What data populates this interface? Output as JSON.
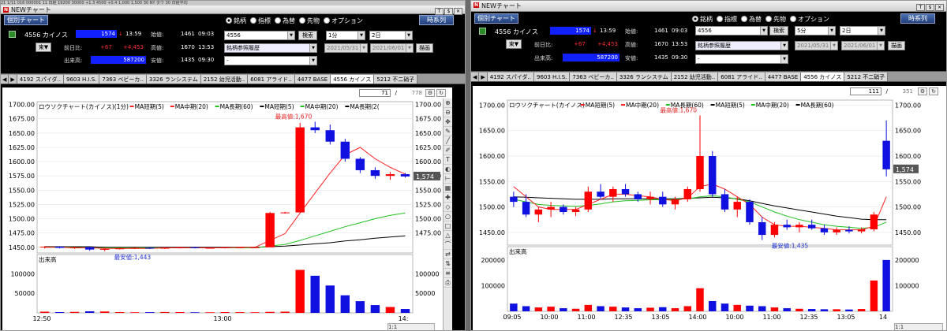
{
  "left_window": {
    "top_strip": "21   1/11     016  000001  11        日経  19200  30000  +1.3   4500  +0.4 1,000   1,500   30        NY ダウ   30   日経平均",
    "title": "NEWチャート",
    "ctrl_icons": [
      "T",
      "$",
      "✕"
    ],
    "mode_btn": "個別チャート",
    "radio_opts": [
      "銘柄",
      "指標",
      "為替",
      "先物",
      "オプション"
    ],
    "ts_btn": "時系列",
    "stock_code": "4556",
    "stock_name": "カイノス",
    "price": "1574",
    "arrow": "↓",
    "time": "13:59",
    "market_btn": "東▼",
    "labels": {
      "start": "始値:",
      "prev": "前日比:",
      "high": "高値:",
      "vol": "出来高:",
      "low": "安値:"
    },
    "start_val": "1461",
    "start_time": "09:03",
    "prev_diff": "+67",
    "prev_pct": "+4,453",
    "high_val": "1670",
    "high_time": "13:53",
    "volume": "587200",
    "low_val": "1435",
    "low_time": "09:30",
    "code_input": "4556",
    "search_btn": "検索",
    "interval": "1分",
    "range": "2日",
    "ref_select": "銘柄参照履歴",
    "date_from": "2021/05/31",
    "date_to": "2021/06/01",
    "draw_btn": "描画",
    "empty_select": "-",
    "tabs": [
      "4192 スパイダ..",
      "9603 H.I.S.",
      "7363 ベビーカ..",
      "3326 ランシステム",
      "2152 幼児活動..",
      "6081 アライド..",
      "4477 BASE",
      "4556 カイノス",
      "5212 不二硝子"
    ],
    "active_tab": 7,
    "nav_l": "◀",
    "nav_r": "▶",
    "count_cur": "71",
    "count_tot": "778",
    "legend": {
      "title": "ロウソクチャート(カイノス)(1分)",
      "s1": "MA短期(5)",
      "s2": "MA中期(20)",
      "s3": "MA長期(60)",
      "s4": "MA短期(5)",
      "s5": "MA中期(20)",
      "s6": "MA長期(2("
    },
    "high_note": "最高値:1,670",
    "low_note": "最安値:1,443",
    "price_tag": "1,574",
    "yaxis": [
      "1700.00",
      "1675.00",
      "1650.00",
      "1625.00",
      "1600.00",
      "1575.00",
      "1550.00",
      "1525.00",
      "1500.00",
      "1475.00",
      "1450.00"
    ],
    "yaxis_r": [
      "1700.00",
      "1675.00",
      "1650.00",
      "1625.00",
      "1600.00",
      "1575.00",
      "1550.00",
      "1525.00",
      "1500.00",
      "1475.00"
    ],
    "vol_title": "出来高",
    "vol_axis": [
      "100000",
      "50000"
    ],
    "vol_axis_l": [
      "100000",
      "50000"
    ],
    "xaxis": [
      "12:50",
      "13:00",
      "14:"
    ],
    "page_ctrl": "1:1"
  },
  "right_window": {
    "title": "NEWチャート",
    "ctrl_icons": [
      "T",
      "$",
      "✕"
    ],
    "mode_btn": "個別チャート",
    "radio_opts": [
      "銘柄",
      "指標",
      "為替",
      "先物",
      "オプション"
    ],
    "ts_btn": "時系列",
    "stock_code": "4556",
    "stock_name": "カイノス",
    "price": "1574",
    "arrow": "↓",
    "time": "13:59",
    "market_btn": "東▼",
    "labels": {
      "start": "始値:",
      "prev": "前日比:",
      "high": "高値:",
      "vol": "出来高:",
      "low": "安値:"
    },
    "start_val": "1461",
    "start_time": "09:03",
    "prev_diff": "+67",
    "prev_pct": "+4,453",
    "high_val": "1670",
    "high_time": "13:53",
    "volume": "587200",
    "low_val": "1435",
    "low_time": "09:30",
    "code_input": "4556",
    "search_btn": "検索",
    "interval": "5分",
    "range": "2日",
    "ref_select": "銘柄参照履歴",
    "date_from": "2021/05/31",
    "date_to": "2021/06/01",
    "draw_btn": "描画",
    "empty_select": "-",
    "tabs": [
      "4192 スパイダ..",
      "9603 H.I.S.",
      "7363 ベビーカ..",
      "3326 ランシステム",
      "2152 幼児活動..",
      "6081 アライド..",
      "4477 BASE",
      "4556 カイノス",
      "5212 不二硝子"
    ],
    "active_tab": 7,
    "nav_l": "◀",
    "nav_r": "▶",
    "count_cur": "111",
    "count_tot": "351",
    "legend": {
      "title": "ロウソクチャート(カイノス)",
      "s1": "MA短期(5)",
      "s2": "MA中期(20)",
      "s3": "MA長期(60)",
      "s4": "MA短期(5)",
      "s5": "MA中期(20)",
      "s6": "MA長期(60)"
    },
    "high_note": "最高値:1,670",
    "low_note": "最安値:1,435",
    "price_tag": "1,574",
    "yaxis": [
      "1700.00",
      "1650.00",
      "1600.00",
      "1550.00",
      "1500.00",
      "1450.00"
    ],
    "yaxis_r": [
      "1700.00",
      "1650.00",
      "1600.00",
      "1550.00",
      "1500.00",
      "1450.00"
    ],
    "vol_title": "出来高",
    "vol_axis": [
      "200000",
      "100000"
    ],
    "vol_axis_l": [
      "200000",
      "100000"
    ],
    "xaxis": [
      "09:05",
      "10:00",
      "11:00",
      "12:35",
      "13:05",
      "14:00",
      "10:00",
      "11:00",
      "12:35",
      "13:05",
      "14"
    ],
    "page_ctrl": "1:1"
  },
  "sidebar_icons": [
    "zoom-in",
    "zoom-out",
    "move",
    "draw",
    "line",
    "pen",
    "text",
    "color",
    "ruler",
    "grid",
    "cross",
    "tool",
    "tool",
    "tool",
    "tool",
    "tool",
    "tool",
    "tool",
    "tool",
    "print"
  ],
  "colors": {
    "up": "#ff0000",
    "down": "#1010e0",
    "ma_short": "#ff2020",
    "ma_mid": "#20c020",
    "ma_long": "#000000",
    "annotation": "#e02020"
  },
  "chart_data": [
    {
      "type": "candlestick",
      "title": "ロウソクチャート(カイノス)(1分)",
      "x_labels": [
        "12:50",
        "13:00",
        "14:"
      ],
      "ylim": [
        1440,
        1705
      ],
      "candles": [
        {
          "o": 1450,
          "h": 1452,
          "l": 1448,
          "c": 1451
        },
        {
          "o": 1451,
          "h": 1452,
          "l": 1448,
          "c": 1449
        },
        {
          "o": 1449,
          "h": 1451,
          "l": 1447,
          "c": 1450
        },
        {
          "o": 1450,
          "h": 1451,
          "l": 1444,
          "c": 1446
        },
        {
          "o": 1446,
          "h": 1449,
          "l": 1443,
          "c": 1447
        },
        {
          "o": 1447,
          "h": 1449,
          "l": 1446,
          "c": 1448
        },
        {
          "o": 1448,
          "h": 1450,
          "l": 1447,
          "c": 1449
        },
        {
          "o": 1449,
          "h": 1450,
          "l": 1447,
          "c": 1448
        },
        {
          "o": 1448,
          "h": 1450,
          "l": 1447,
          "c": 1449
        },
        {
          "o": 1449,
          "h": 1451,
          "l": 1448,
          "c": 1450
        },
        {
          "o": 1450,
          "h": 1451,
          "l": 1448,
          "c": 1449
        },
        {
          "o": 1449,
          "h": 1450,
          "l": 1448,
          "c": 1449
        },
        {
          "o": 1449,
          "h": 1450,
          "l": 1448,
          "c": 1450
        },
        {
          "o": 1450,
          "h": 1451,
          "l": 1449,
          "c": 1450
        },
        {
          "o": 1450,
          "h": 1451,
          "l": 1449,
          "c": 1450
        },
        {
          "o": 1450,
          "h": 1512,
          "l": 1450,
          "c": 1510
        },
        {
          "o": 1510,
          "h": 1512,
          "l": 1509,
          "c": 1511
        },
        {
          "o": 1511,
          "h": 1668,
          "l": 1640,
          "c": 1660
        },
        {
          "o": 1660,
          "h": 1670,
          "l": 1650,
          "c": 1655
        },
        {
          "o": 1655,
          "h": 1665,
          "l": 1630,
          "c": 1635
        },
        {
          "o": 1635,
          "h": 1640,
          "l": 1600,
          "c": 1605
        },
        {
          "o": 1605,
          "h": 1608,
          "l": 1580,
          "c": 1585
        },
        {
          "o": 1585,
          "h": 1590,
          "l": 1570,
          "c": 1575
        },
        {
          "o": 1575,
          "h": 1582,
          "l": 1568,
          "c": 1578
        },
        {
          "o": 1578,
          "h": 1580,
          "l": 1572,
          "c": 1574
        }
      ],
      "ma_short": [
        1450,
        1450,
        1449,
        1449,
        1448,
        1448,
        1448,
        1448,
        1449,
        1449,
        1449,
        1449,
        1449,
        1450,
        1450,
        1462,
        1474,
        1510,
        1545,
        1580,
        1612,
        1625,
        1605,
        1590,
        1578
      ],
      "ma_mid": [
        1450,
        1450,
        1450,
        1449,
        1449,
        1449,
        1449,
        1449,
        1449,
        1449,
        1449,
        1449,
        1449,
        1449,
        1449,
        1452,
        1455,
        1462,
        1470,
        1478,
        1486,
        1493,
        1500,
        1506,
        1510
      ],
      "ma_long": [
        1451,
        1451,
        1451,
        1451,
        1450,
        1450,
        1450,
        1450,
        1450,
        1450,
        1450,
        1450,
        1450,
        1450,
        1450,
        1451,
        1452,
        1454,
        1456,
        1458,
        1461,
        1463,
        1466,
        1468,
        1470
      ],
      "volume": [
        3000,
        2000,
        2500,
        4000,
        3500,
        2000,
        1500,
        1800,
        2200,
        2000,
        1500,
        1500,
        2000,
        1800,
        1500,
        2500,
        3000,
        110000,
        95000,
        70000,
        45000,
        30000,
        20000,
        15000,
        10000
      ],
      "high_note": "最高値:1,670",
      "low_note": "最安値:1,443"
    },
    {
      "type": "candlestick",
      "title": "ロウソクチャート(カイノス)",
      "x_labels": [
        "09:05",
        "10:00",
        "11:00",
        "12:35",
        "13:05",
        "14:00",
        "10:00",
        "11:00",
        "12:35",
        "13:05",
        "14"
      ],
      "ylim": [
        1425,
        1710
      ],
      "candles": [
        {
          "o": 1520,
          "h": 1530,
          "l": 1500,
          "c": 1510
        },
        {
          "o": 1510,
          "h": 1525,
          "l": 1480,
          "c": 1485
        },
        {
          "o": 1485,
          "h": 1500,
          "l": 1470,
          "c": 1495
        },
        {
          "o": 1495,
          "h": 1510,
          "l": 1480,
          "c": 1500
        },
        {
          "o": 1500,
          "h": 1505,
          "l": 1485,
          "c": 1490
        },
        {
          "o": 1490,
          "h": 1500,
          "l": 1482,
          "c": 1495
        },
        {
          "o": 1495,
          "h": 1540,
          "l": 1490,
          "c": 1530
        },
        {
          "o": 1530,
          "h": 1545,
          "l": 1515,
          "c": 1520
        },
        {
          "o": 1520,
          "h": 1540,
          "l": 1510,
          "c": 1535
        },
        {
          "o": 1535,
          "h": 1545,
          "l": 1520,
          "c": 1525
        },
        {
          "o": 1525,
          "h": 1530,
          "l": 1510,
          "c": 1515
        },
        {
          "o": 1515,
          "h": 1530,
          "l": 1505,
          "c": 1520
        },
        {
          "o": 1520,
          "h": 1530,
          "l": 1500,
          "c": 1505
        },
        {
          "o": 1505,
          "h": 1520,
          "l": 1495,
          "c": 1515
        },
        {
          "o": 1515,
          "h": 1540,
          "l": 1510,
          "c": 1535
        },
        {
          "o": 1535,
          "h": 1680,
          "l": 1530,
          "c": 1600
        },
        {
          "o": 1600,
          "h": 1610,
          "l": 1520,
          "c": 1525
        },
        {
          "o": 1525,
          "h": 1535,
          "l": 1490,
          "c": 1495
        },
        {
          "o": 1495,
          "h": 1520,
          "l": 1480,
          "c": 1510
        },
        {
          "o": 1510,
          "h": 1515,
          "l": 1465,
          "c": 1470
        },
        {
          "o": 1470,
          "h": 1480,
          "l": 1435,
          "c": 1445
        },
        {
          "o": 1445,
          "h": 1470,
          "l": 1440,
          "c": 1465
        },
        {
          "o": 1465,
          "h": 1475,
          "l": 1455,
          "c": 1460
        },
        {
          "o": 1460,
          "h": 1470,
          "l": 1450,
          "c": 1465
        },
        {
          "o": 1465,
          "h": 1475,
          "l": 1455,
          "c": 1458
        },
        {
          "o": 1458,
          "h": 1465,
          "l": 1445,
          "c": 1450
        },
        {
          "o": 1450,
          "h": 1460,
          "l": 1445,
          "c": 1455
        },
        {
          "o": 1455,
          "h": 1462,
          "l": 1448,
          "c": 1452
        },
        {
          "o": 1452,
          "h": 1460,
          "l": 1448,
          "c": 1456
        },
        {
          "o": 1456,
          "h": 1490,
          "l": 1452,
          "c": 1485
        },
        {
          "o": 1630,
          "h": 1670,
          "l": 1560,
          "c": 1574
        }
      ],
      "ma_short": [
        1540,
        1520,
        1500,
        1495,
        1495,
        1495,
        1505,
        1515,
        1525,
        1525,
        1522,
        1520,
        1515,
        1512,
        1518,
        1540,
        1545,
        1535,
        1520,
        1505,
        1480,
        1465,
        1462,
        1462,
        1460,
        1458,
        1455,
        1455,
        1455,
        1462,
        1520
      ],
      "ma_mid": [
        1515,
        1510,
        1505,
        1503,
        1502,
        1501,
        1503,
        1506,
        1510,
        1512,
        1513,
        1514,
        1514,
        1515,
        1516,
        1520,
        1522,
        1520,
        1515,
        1510,
        1500,
        1490,
        1482,
        1475,
        1470,
        1465,
        1462,
        1460,
        1458,
        1460,
        1470
      ],
      "ma_long": [
        1520,
        1519,
        1518,
        1517,
        1516,
        1515,
        1515,
        1515,
        1516,
        1516,
        1516,
        1516,
        1516,
        1516,
        1517,
        1518,
        1519,
        1518,
        1516,
        1512,
        1507,
        1502,
        1498,
        1494,
        1490,
        1486,
        1482,
        1479,
        1476,
        1475,
        1475
      ],
      "volume": [
        30000,
        20000,
        15000,
        18000,
        12000,
        10000,
        25000,
        20000,
        18000,
        15000,
        12000,
        14000,
        16000,
        12000,
        20000,
        90000,
        40000,
        30000,
        25000,
        22000,
        20000,
        15000,
        12000,
        10000,
        9000,
        8000,
        8000,
        7000,
        9000,
        120000,
        200000
      ],
      "high_note": "最高値:1,670",
      "low_note": "最安値:1,435"
    }
  ]
}
